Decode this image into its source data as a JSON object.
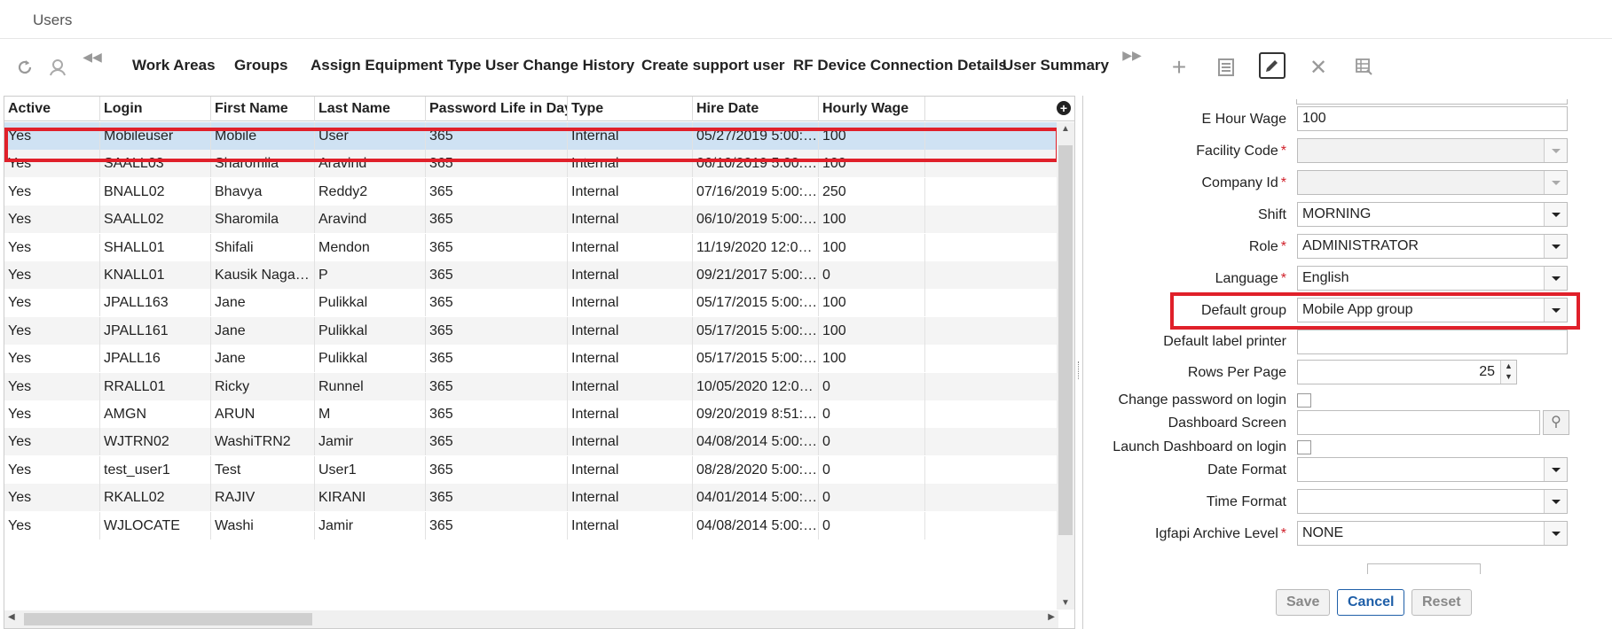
{
  "page": {
    "title": "Users"
  },
  "toolbar": {
    "links": [
      "Work Areas",
      "Groups",
      "Assign Equipment Type",
      "User Change History",
      "Create support user",
      "RF Device Connection Details",
      "User Summary"
    ]
  },
  "grid": {
    "columns": [
      "Active",
      "Login",
      "First Name",
      "Last Name",
      "Password Life in Days",
      "Type",
      "Hire Date",
      "Hourly Wage"
    ],
    "rows": [
      [
        "Yes",
        "Mobileuser",
        "Mobile",
        "User",
        "365",
        "Internal",
        "05/27/2019 5:00:0...",
        "100"
      ],
      [
        "Yes",
        "SAALL03",
        "Sharomila",
        "Aravind",
        "365",
        "Internal",
        "06/10/2019 5:00:0...",
        "100"
      ],
      [
        "Yes",
        "BNALL02",
        "Bhavya",
        "Reddy2",
        "365",
        "Internal",
        "07/16/2019 5:00:0...",
        "250"
      ],
      [
        "Yes",
        "SAALL02",
        "Sharomila",
        "Aravind",
        "365",
        "Internal",
        "06/10/2019 5:00:0...",
        "100"
      ],
      [
        "Yes",
        "SHALL01",
        "Shifali",
        "Mendon",
        "365",
        "Internal",
        "11/19/2020 12:00:0...",
        "100"
      ],
      [
        "Yes",
        "KNALL01",
        "Kausik Nagara...",
        "P",
        "365",
        "Internal",
        "09/21/2017 5:00:0...",
        "0"
      ],
      [
        "Yes",
        "JPALL163",
        "Jane",
        "Pulikkal",
        "365",
        "Internal",
        "05/17/2015 5:00:0...",
        "100"
      ],
      [
        "Yes",
        "JPALL161",
        "Jane",
        "Pulikkal",
        "365",
        "Internal",
        "05/17/2015 5:00:0...",
        "100"
      ],
      [
        "Yes",
        "JPALL16",
        "Jane",
        "Pulikkal",
        "365",
        "Internal",
        "05/17/2015 5:00:0...",
        "100"
      ],
      [
        "Yes",
        "RRALL01",
        "Ricky",
        "Runnel",
        "365",
        "Internal",
        "10/05/2020 12:00:...",
        "0"
      ],
      [
        "Yes",
        "AMGN",
        "ARUN",
        "M",
        "365",
        "Internal",
        "09/20/2019 8:51:4...",
        "0"
      ],
      [
        "Yes",
        "WJTRN02",
        "WashiTRN2",
        "Jamir",
        "365",
        "Internal",
        "04/08/2014 5:00:0...",
        "0"
      ],
      [
        "Yes",
        "test_user1",
        "Test",
        "User1",
        "365",
        "Internal",
        "08/28/2020 5:00:0...",
        "0"
      ],
      [
        "Yes",
        "RKALL02",
        "RAJIV",
        "KIRANI",
        "365",
        "Internal",
        "04/01/2014 5:00:0...",
        "0"
      ],
      [
        "Yes",
        "WJLOCATE",
        "Washi",
        "Jamir",
        "365",
        "Internal",
        "04/08/2014 5:00:0...",
        "0"
      ]
    ]
  },
  "form": {
    "e_hour_wage": {
      "label": "E Hour Wage",
      "value": "100"
    },
    "facility_code": {
      "label": "Facility Code",
      "value": ""
    },
    "company_id": {
      "label": "Company Id",
      "value": ""
    },
    "shift": {
      "label": "Shift",
      "value": "MORNING"
    },
    "role": {
      "label": "Role",
      "value": "ADMINISTRATOR"
    },
    "language": {
      "label": "Language",
      "value": "English"
    },
    "default_group": {
      "label": "Default group",
      "value": "Mobile App group"
    },
    "default_label_printer": {
      "label": "Default label printer",
      "value": ""
    },
    "rows_per_page": {
      "label": "Rows Per Page",
      "value": "25"
    },
    "change_password": {
      "label": "Change password on login"
    },
    "dashboard_screen": {
      "label": "Dashboard Screen",
      "value": ""
    },
    "launch_dashboard": {
      "label": "Launch Dashboard on login"
    },
    "date_format": {
      "label": "Date Format",
      "value": ""
    },
    "time_format": {
      "label": "Time Format",
      "value": ""
    },
    "archive_level": {
      "label": "Igfapi Archive Level",
      "value": "NONE"
    },
    "required_mark": "*"
  },
  "buttons": {
    "save": "Save",
    "cancel": "Cancel",
    "reset": "Reset"
  }
}
